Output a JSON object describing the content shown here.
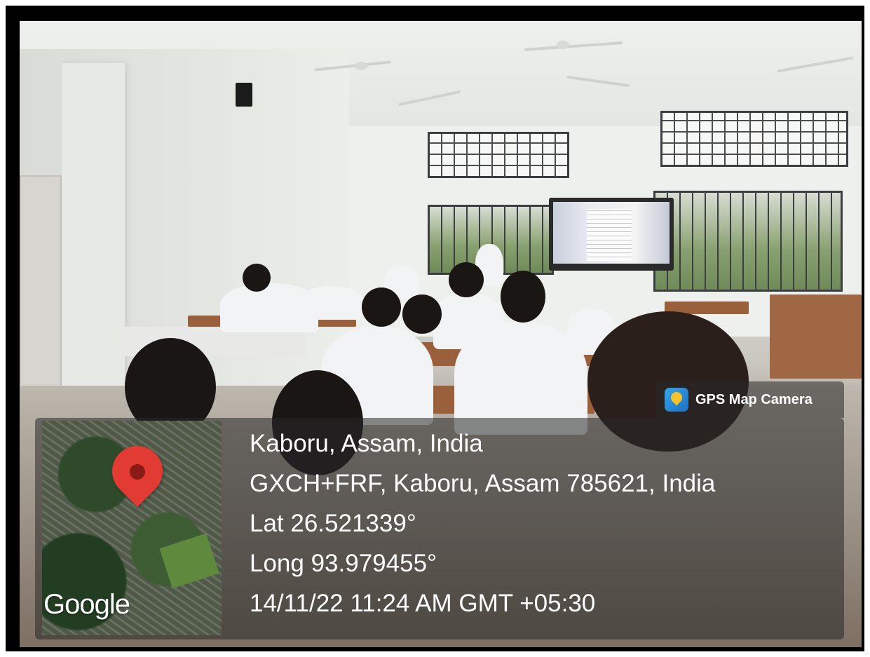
{
  "overlay": {
    "app_label": "GPS Map Camera",
    "app_icon": "gps-map-camera-icon",
    "map_logo": "Google",
    "location_title": "Kaboru, Assam, India",
    "address": "GXCH+FRF, Kaboru, Assam 785621, India",
    "latitude": "Lat 26.521339°",
    "longitude": "Long 93.979455°",
    "datetime": "14/11/22 11:24 AM GMT +05:30"
  },
  "colors": {
    "overlay_bg": "#282828",
    "pin": "#e23b33",
    "text": "#ffffff"
  }
}
